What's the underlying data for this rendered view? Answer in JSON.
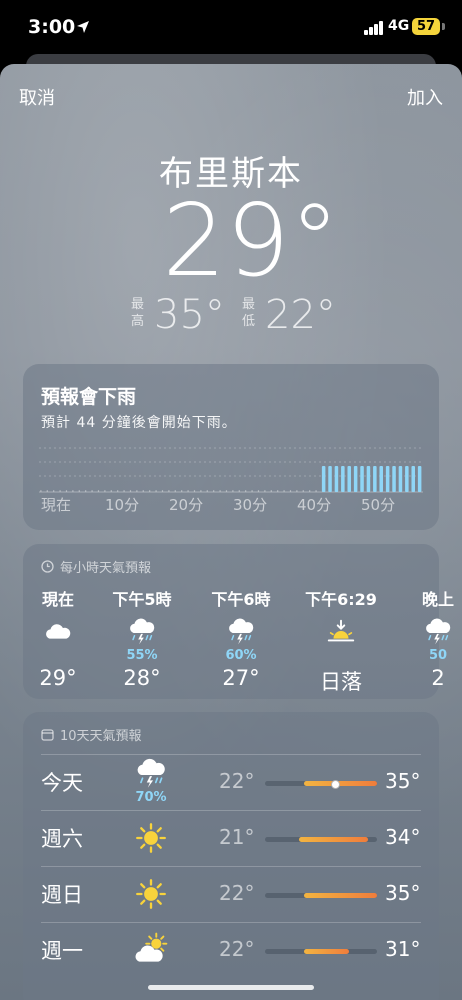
{
  "status_bar": {
    "time": "3:00",
    "network": "4G",
    "battery": "57"
  },
  "nav": {
    "cancel_label": "取消",
    "add_label": "加入"
  },
  "location": {
    "city": "布里斯本",
    "current_temp": "29°",
    "high_label": "最高",
    "high_value": "35°",
    "low_label": "最低",
    "low_value": "22°"
  },
  "rain_card": {
    "title": "預報會下雨",
    "subtitle": "預計 44 分鐘後會開始下雨。",
    "rain_start_minute": 44,
    "ticks": [
      "現在",
      "10分",
      "20分",
      "30分",
      "40分",
      "50分"
    ]
  },
  "hourly": {
    "header": "每小時天氣預報",
    "items": [
      {
        "label": "現在",
        "icon": "cloud-icon",
        "pct": "",
        "temp": "29°"
      },
      {
        "label": "下午5時",
        "icon": "thunderstorm-rain-icon",
        "pct": "55%",
        "temp": "28°"
      },
      {
        "label": "下午6時",
        "icon": "thunderstorm-rain-icon",
        "pct": "60%",
        "temp": "27°"
      },
      {
        "label": "下午6:29",
        "icon": "sunset-icon",
        "pct": "",
        "temp": "日落"
      },
      {
        "label": "晚上",
        "icon": "thunderstorm-rain-icon",
        "pct": "50",
        "temp": "2"
      }
    ]
  },
  "daily": {
    "header": "10天天氣預報",
    "days": [
      {
        "name": "今天",
        "icon": "thunderstorm-rain-icon",
        "pct": "70%",
        "low": "22°",
        "high": "35°",
        "bar_start": 0.35,
        "bar_end": 1.0,
        "now_marker": 0.62
      },
      {
        "name": "週六",
        "icon": "sun-icon",
        "pct": "",
        "low": "21°",
        "high": "34°",
        "bar_start": 0.3,
        "bar_end": 0.92
      },
      {
        "name": "週日",
        "icon": "sun-icon",
        "pct": "",
        "low": "22°",
        "high": "35°",
        "bar_start": 0.35,
        "bar_end": 1.0
      },
      {
        "name": "週一",
        "icon": "partly-cloudy-sun-icon",
        "pct": "",
        "low": "22°",
        "high": "31°",
        "bar_start": 0.35,
        "bar_end": 0.75
      }
    ]
  },
  "colors": {
    "precip": "#8fd6f7",
    "temp_bar_warm": "#f2b441",
    "temp_bar_hot": "#ef7d3c",
    "sun": "#f8d33c"
  }
}
